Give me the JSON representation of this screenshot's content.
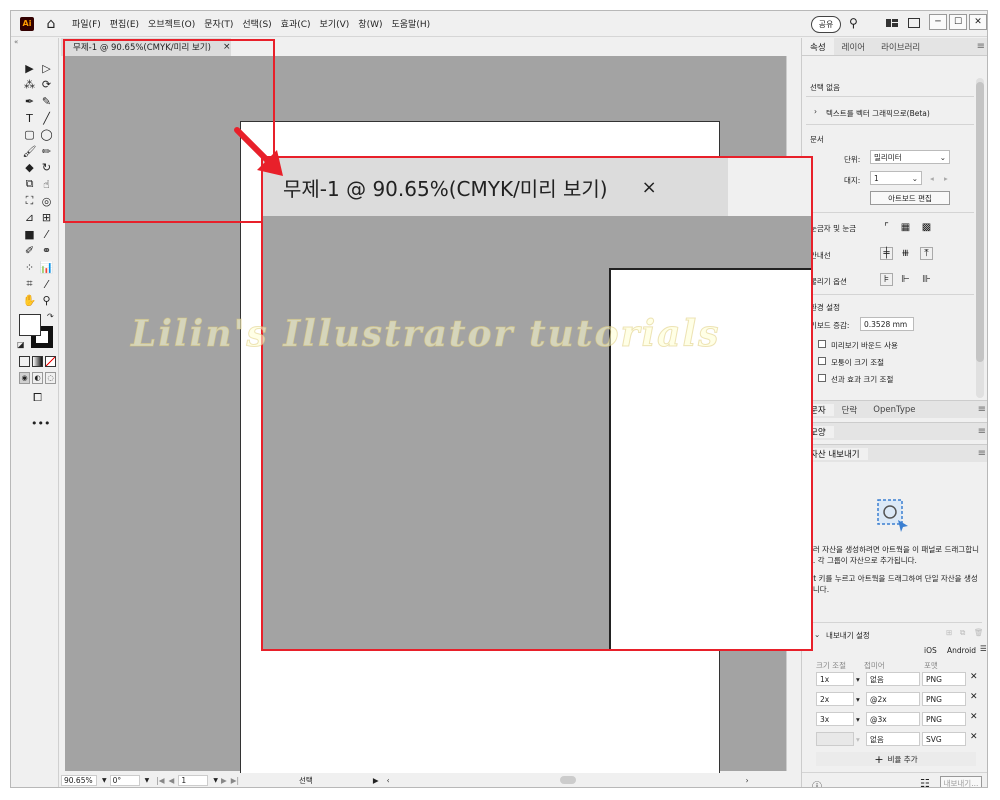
{
  "app": {
    "logo": "Ai"
  },
  "menu": {
    "items": [
      "파일(F)",
      "편집(E)",
      "오브젝트(O)",
      "문자(T)",
      "선택(S)",
      "효과(C)",
      "보기(V)",
      "창(W)",
      "도움말(H)"
    ],
    "share_label": "공유",
    "window_buttons": [
      "─",
      "☐",
      "✕"
    ]
  },
  "document": {
    "tab_title": "무제-1 @ 90.65%(CMYK/미리 보기)",
    "tab_close": "×"
  },
  "status": {
    "zoom": "90.65%",
    "rotation": "0°",
    "page": "1",
    "tool": "선택"
  },
  "callout": {
    "tab_title": "무제-1 @ 90.65%(CMYK/미리 보기)",
    "tab_close": "×",
    "watermark": "Lilin's Illustrator tutorials",
    "accent_color": "#e8202a"
  },
  "props_panel": {
    "tabs": [
      "속성",
      "레이어",
      "라이브러리"
    ],
    "no_selection": "선택 없음",
    "vectorize": "텍스트를 벡터 그래픽으로(Beta)",
    "document_label": "문서",
    "unit_label": "단위:",
    "unit_value": "밀리미터",
    "artboard_label": "대지:",
    "artboard_value": "1",
    "edit_artboards": "아트보드 편집",
    "rulers_grid": "눈금자 및 눈금",
    "guides": "안내선",
    "snap_options": "물리기 옵션",
    "preferences": "환경 설정",
    "keyboard_increment_label": "키보드 증감:",
    "keyboard_increment_value": "0.3528 mm",
    "checkbox_1": "미리보기 바운드 사용",
    "checkbox_2": "모퉁이 크기 조절",
    "checkbox_3": "선과 효과 크기 조절"
  },
  "text_panel": {
    "tabs": [
      "문자",
      "단락",
      "OpenType"
    ],
    "shape_tab": "모양"
  },
  "export_panel": {
    "title": "자산 내보내기",
    "desc1": "여러 자산을 생성하려면 아트웍을 이 패널로 드래그합니다. 각 그룹이 자산으로 추가됩니다.",
    "desc2": "Alt 키를 누르고 아트웍을 드래그하여 단일 자산을 생성합니다.",
    "settings_label": "내보내기 설정",
    "ios": "iOS",
    "android": "Android",
    "col_scale": "크기 조절",
    "col_suffix": "접미어",
    "col_format": "포맷",
    "rows": [
      {
        "scale": "1x",
        "suffix": "없음",
        "format": "PNG"
      },
      {
        "scale": "2x",
        "suffix": "@2x",
        "format": "PNG"
      },
      {
        "scale": "3x",
        "suffix": "@3x",
        "format": "PNG"
      },
      {
        "scale": "",
        "suffix": "없음",
        "format": "SVG"
      }
    ],
    "add_scale": "비율 추가",
    "export_button": "내보내기..."
  }
}
